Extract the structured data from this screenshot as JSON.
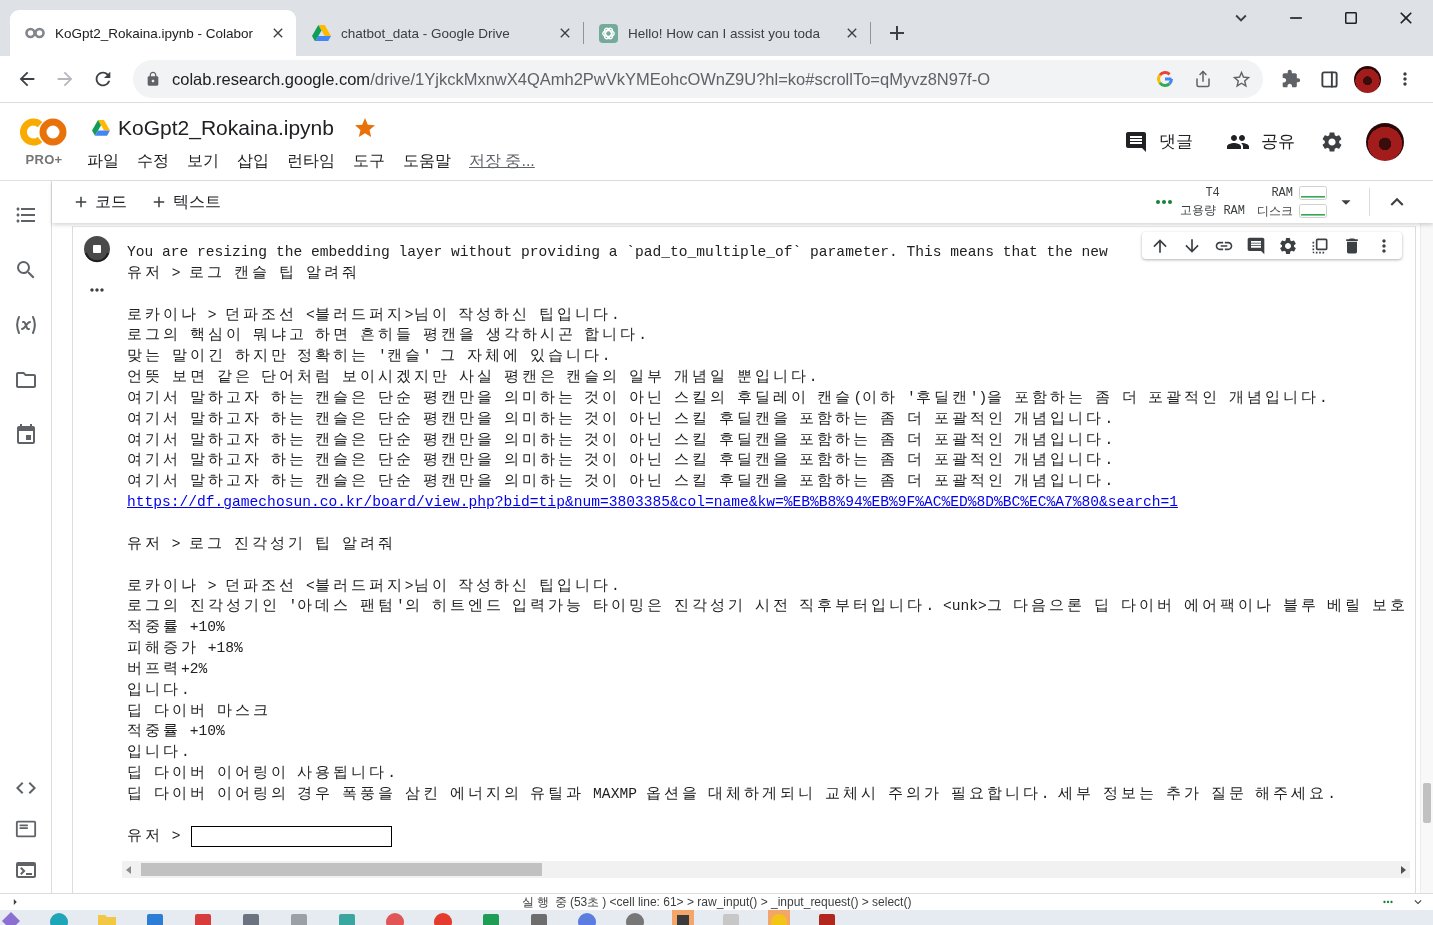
{
  "browser": {
    "tabs": [
      {
        "title": "KoGpt2_Rokaina.ipynb - Colabor",
        "kind": "rings",
        "selected": true
      },
      {
        "title": "chatbot_data - Google Drive",
        "kind": "drive",
        "selected": false
      },
      {
        "title": "Hello! How can I assist you toda",
        "kind": "knot",
        "selected": false
      }
    ],
    "can_go_forward": false,
    "address": {
      "host": "colab.research.google.com",
      "path": "/drive/1YjkckMxnwX4QAmh2PwVkYMEohcOWnZ9U?hl=ko#scrollTo=qMyvz8N97f-O"
    },
    "bookmarked": false
  },
  "notebook": {
    "logo_badge": "PRO+",
    "title": "KoGpt2_Rokaina.ipynb",
    "starred": true,
    "menu": [
      "파일",
      "수정",
      "보기",
      "삽입",
      "런타임",
      "도구",
      "도움말"
    ],
    "save_status": "저장 중...",
    "comments_button": "댓글",
    "share_button": "공유"
  },
  "toolbar": {
    "add_code": "코드",
    "add_text": "텍스트",
    "runtime": {
      "busy": true,
      "accelerator": "T4",
      "memory_type": "고용량 RAM",
      "meters": [
        {
          "label": "RAM"
        },
        {
          "label": "디스크"
        }
      ]
    }
  },
  "cell": {
    "running": true
  },
  "output": {
    "blocks": [
      [
        {
          "kind": "text",
          "text": "You are resizing the embedding layer without providing a `pad_to_multiple_of` parameter. This means that the new"
        },
        {
          "kind": "text",
          "text": "유저 > 로그 캔슬 팁 알려줘"
        }
      ],
      [
        {
          "kind": "text",
          "text": "로카이나 > 던파조선 <블러드퍼지>님이 작성하신 팁입니다."
        },
        {
          "kind": "text",
          "text": "로그의 핵심이 뭐냐고 하면 흔히들 평캔을 생각하시곤 합니다."
        },
        {
          "kind": "text",
          "text": "맞는 말이긴 하지만 정확히는 '캔슬' 그 자체에 있습니다."
        },
        {
          "kind": "text",
          "text": "언뜻 보면 같은 단어처럼 보이시겠지만 사실 평캔은 캔슬의 일부 개념일 뿐입니다."
        },
        {
          "kind": "text",
          "text": "여기서 말하고자 하는 캔슬은 단순 평캔만을 의미하는 것이 아닌 스킬의 후딜레이 캔슬(이하 '후딜캔')을 포함하는 좀 더 포괄적인 개념입니다."
        },
        {
          "kind": "text",
          "text": "여기서 말하고자 하는 캔슬은 단순 평캔만을 의미하는 것이 아닌 스킬 후딜캔을 포함하는 좀 더 포괄적인 개념입니다."
        },
        {
          "kind": "text",
          "text": "여기서 말하고자 하는 캔슬은 단순 평캔만을 의미하는 것이 아닌 스킬 후딜캔을 포함하는 좀 더 포괄적인 개념입니다."
        },
        {
          "kind": "text",
          "text": "여기서 말하고자 하는 캔슬은 단순 평캔만을 의미하는 것이 아닌 스킬 후딜캔을 포함하는 좀 더 포괄적인 개념입니다."
        },
        {
          "kind": "text",
          "text": "여기서 말하고자 하는 캔슬은 단순 평캔만을 의미하는 것이 아닌 스킬 후딜캔을 포함하는 좀 더 포괄적인 개념입니다."
        },
        {
          "kind": "link",
          "text": "https://df.gamechosun.co.kr/board/view.php?bid=tip&num=3803385&col=name&kw=%EB%B8%94%EB%9F%AC%ED%8D%BC%EC%A7%80&search=1"
        }
      ],
      [
        {
          "kind": "text",
          "text": "유저 > 로그 진각성기 팁 알려줘"
        }
      ],
      [
        {
          "kind": "text",
          "text": "로카이나 > 던파조선 <블러드퍼지>님이 작성하신 팁입니다."
        },
        {
          "kind": "text",
          "text": "로그의 진각성기인 '아데스 팬텀'의 히트엔드 입력가능 타이밍은 진각성기 시전 직후부터입니다. <unk>그 다음으론 딥 다이버 에어팩이나 블루 베릴 보호"
        },
        {
          "kind": "text",
          "text": "적중률 +10%"
        },
        {
          "kind": "text",
          "text": "피해증가 +18%"
        },
        {
          "kind": "text",
          "text": "버프력+2%"
        },
        {
          "kind": "text",
          "text": "입니다."
        },
        {
          "kind": "text",
          "text": "딥 다이버 마스크"
        },
        {
          "kind": "text",
          "text": "적중률 +10%"
        },
        {
          "kind": "text",
          "text": "입니다."
        },
        {
          "kind": "text",
          "text": "딥 다이버 이어링이 사용됩니다."
        },
        {
          "kind": "text",
          "text": "딥 다이버 이어링의 경우 폭풍을 삼킨 에너지의 유틸과 MAXMP 옵션을 대체하게되니 교체시 주의가 필요합니다. 세부 정보는 추가 질문 해주세요."
        }
      ]
    ],
    "input": {
      "prompt": "유저 >"
    }
  },
  "status_bar": {
    "text": "실행 중(53초) <cell line: 61> > raw_input() > _input_request() > select()"
  }
}
